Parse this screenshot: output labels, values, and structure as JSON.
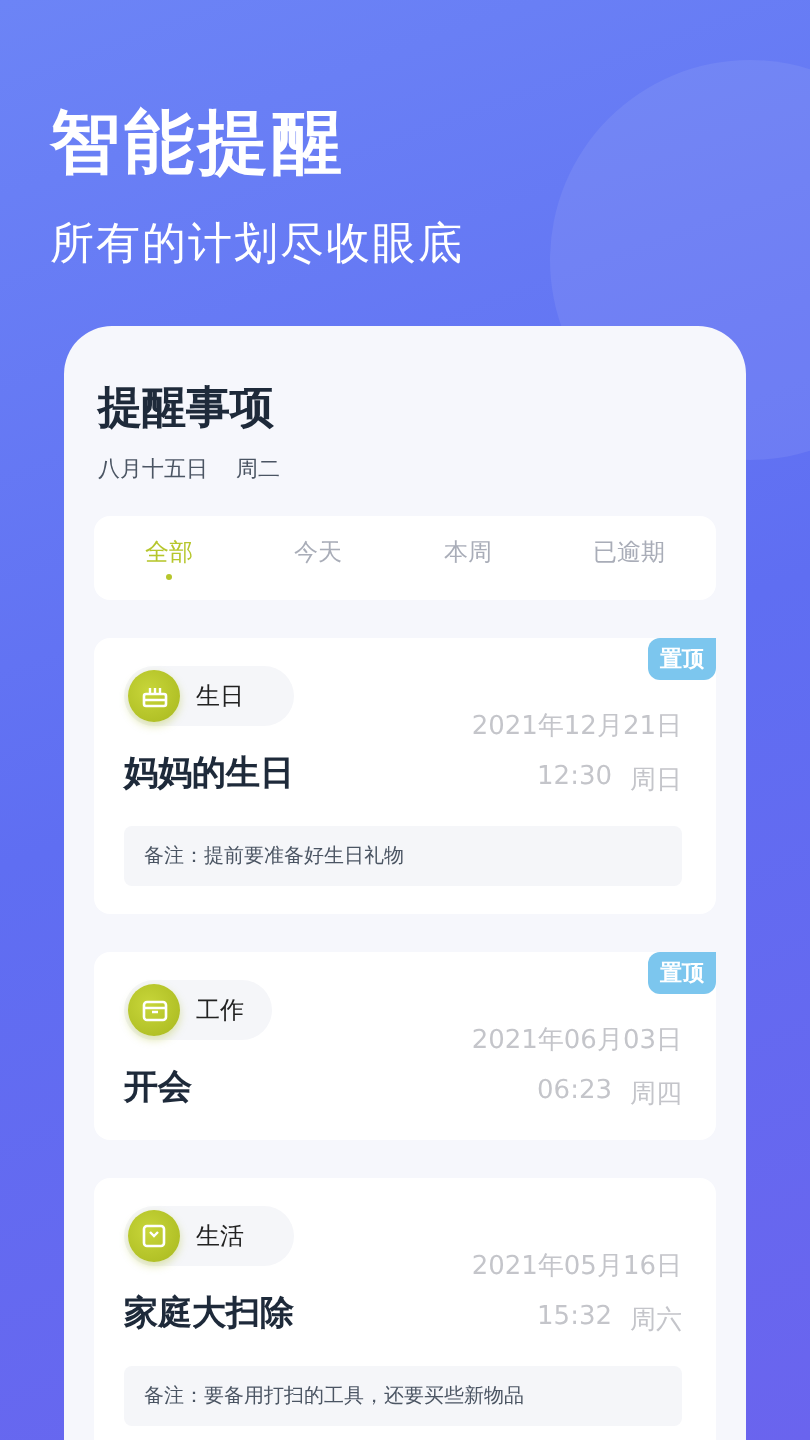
{
  "hero": {
    "title": "智能提醒",
    "subtitle": "所有的计划尽收眼底"
  },
  "panel": {
    "title": "提醒事项",
    "date": "八月十五日",
    "weekday": "周二"
  },
  "tabs": [
    {
      "label": "全部",
      "selected": true
    },
    {
      "label": "今天",
      "selected": false
    },
    {
      "label": "本周",
      "selected": false
    },
    {
      "label": "已逾期",
      "selected": false
    }
  ],
  "reminders": [
    {
      "category": "生日",
      "kind": "birthday",
      "pinned": true,
      "pin_label": "置顶",
      "title": "妈妈的生日",
      "date": "2021年12月21日",
      "time": "12:30",
      "weekday": "周日",
      "note": "备注：提前要准备好生日礼物"
    },
    {
      "category": "工作",
      "kind": "work",
      "pinned": true,
      "pin_label": "置顶",
      "title": "开会",
      "date": "2021年06月03日",
      "time": "06:23",
      "weekday": "周四"
    },
    {
      "category": "生活",
      "kind": "life",
      "pinned": false,
      "title": "家庭大扫除",
      "date": "2021年05月16日",
      "time": "15:32",
      "weekday": "周六",
      "note": "备注：要备用打扫的工具，还要买些新物品"
    }
  ]
}
